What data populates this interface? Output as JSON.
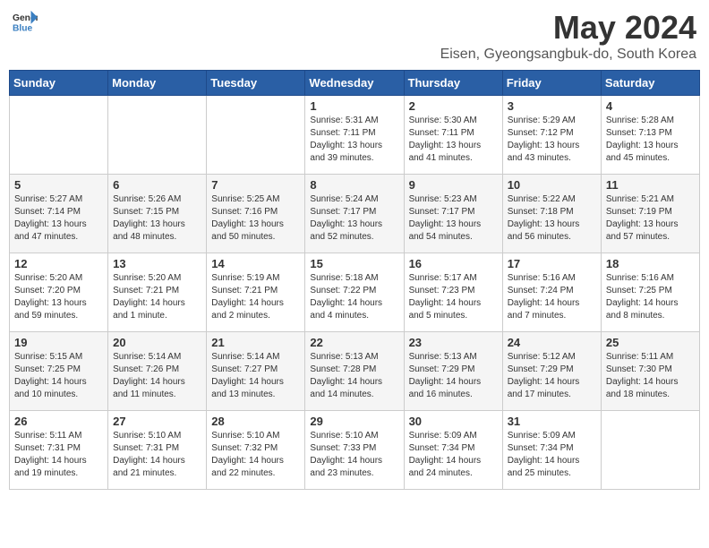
{
  "logo": {
    "text_general": "General",
    "text_blue": "Blue"
  },
  "title": "May 2024",
  "subtitle": "Eisen, Gyeongsangbuk-do, South Korea",
  "days_of_week": [
    "Sunday",
    "Monday",
    "Tuesday",
    "Wednesday",
    "Thursday",
    "Friday",
    "Saturday"
  ],
  "weeks": [
    [
      {
        "day": "",
        "info": ""
      },
      {
        "day": "",
        "info": ""
      },
      {
        "day": "",
        "info": ""
      },
      {
        "day": "1",
        "info": "Sunrise: 5:31 AM\nSunset: 7:11 PM\nDaylight: 13 hours\nand 39 minutes."
      },
      {
        "day": "2",
        "info": "Sunrise: 5:30 AM\nSunset: 7:11 PM\nDaylight: 13 hours\nand 41 minutes."
      },
      {
        "day": "3",
        "info": "Sunrise: 5:29 AM\nSunset: 7:12 PM\nDaylight: 13 hours\nand 43 minutes."
      },
      {
        "day": "4",
        "info": "Sunrise: 5:28 AM\nSunset: 7:13 PM\nDaylight: 13 hours\nand 45 minutes."
      }
    ],
    [
      {
        "day": "5",
        "info": "Sunrise: 5:27 AM\nSunset: 7:14 PM\nDaylight: 13 hours\nand 47 minutes."
      },
      {
        "day": "6",
        "info": "Sunrise: 5:26 AM\nSunset: 7:15 PM\nDaylight: 13 hours\nand 48 minutes."
      },
      {
        "day": "7",
        "info": "Sunrise: 5:25 AM\nSunset: 7:16 PM\nDaylight: 13 hours\nand 50 minutes."
      },
      {
        "day": "8",
        "info": "Sunrise: 5:24 AM\nSunset: 7:17 PM\nDaylight: 13 hours\nand 52 minutes."
      },
      {
        "day": "9",
        "info": "Sunrise: 5:23 AM\nSunset: 7:17 PM\nDaylight: 13 hours\nand 54 minutes."
      },
      {
        "day": "10",
        "info": "Sunrise: 5:22 AM\nSunset: 7:18 PM\nDaylight: 13 hours\nand 56 minutes."
      },
      {
        "day": "11",
        "info": "Sunrise: 5:21 AM\nSunset: 7:19 PM\nDaylight: 13 hours\nand 57 minutes."
      }
    ],
    [
      {
        "day": "12",
        "info": "Sunrise: 5:20 AM\nSunset: 7:20 PM\nDaylight: 13 hours\nand 59 minutes."
      },
      {
        "day": "13",
        "info": "Sunrise: 5:20 AM\nSunset: 7:21 PM\nDaylight: 14 hours\nand 1 minute."
      },
      {
        "day": "14",
        "info": "Sunrise: 5:19 AM\nSunset: 7:21 PM\nDaylight: 14 hours\nand 2 minutes."
      },
      {
        "day": "15",
        "info": "Sunrise: 5:18 AM\nSunset: 7:22 PM\nDaylight: 14 hours\nand 4 minutes."
      },
      {
        "day": "16",
        "info": "Sunrise: 5:17 AM\nSunset: 7:23 PM\nDaylight: 14 hours\nand 5 minutes."
      },
      {
        "day": "17",
        "info": "Sunrise: 5:16 AM\nSunset: 7:24 PM\nDaylight: 14 hours\nand 7 minutes."
      },
      {
        "day": "18",
        "info": "Sunrise: 5:16 AM\nSunset: 7:25 PM\nDaylight: 14 hours\nand 8 minutes."
      }
    ],
    [
      {
        "day": "19",
        "info": "Sunrise: 5:15 AM\nSunset: 7:25 PM\nDaylight: 14 hours\nand 10 minutes."
      },
      {
        "day": "20",
        "info": "Sunrise: 5:14 AM\nSunset: 7:26 PM\nDaylight: 14 hours\nand 11 minutes."
      },
      {
        "day": "21",
        "info": "Sunrise: 5:14 AM\nSunset: 7:27 PM\nDaylight: 14 hours\nand 13 minutes."
      },
      {
        "day": "22",
        "info": "Sunrise: 5:13 AM\nSunset: 7:28 PM\nDaylight: 14 hours\nand 14 minutes."
      },
      {
        "day": "23",
        "info": "Sunrise: 5:13 AM\nSunset: 7:29 PM\nDaylight: 14 hours\nand 16 minutes."
      },
      {
        "day": "24",
        "info": "Sunrise: 5:12 AM\nSunset: 7:29 PM\nDaylight: 14 hours\nand 17 minutes."
      },
      {
        "day": "25",
        "info": "Sunrise: 5:11 AM\nSunset: 7:30 PM\nDaylight: 14 hours\nand 18 minutes."
      }
    ],
    [
      {
        "day": "26",
        "info": "Sunrise: 5:11 AM\nSunset: 7:31 PM\nDaylight: 14 hours\nand 19 minutes."
      },
      {
        "day": "27",
        "info": "Sunrise: 5:10 AM\nSunset: 7:31 PM\nDaylight: 14 hours\nand 21 minutes."
      },
      {
        "day": "28",
        "info": "Sunrise: 5:10 AM\nSunset: 7:32 PM\nDaylight: 14 hours\nand 22 minutes."
      },
      {
        "day": "29",
        "info": "Sunrise: 5:10 AM\nSunset: 7:33 PM\nDaylight: 14 hours\nand 23 minutes."
      },
      {
        "day": "30",
        "info": "Sunrise: 5:09 AM\nSunset: 7:34 PM\nDaylight: 14 hours\nand 24 minutes."
      },
      {
        "day": "31",
        "info": "Sunrise: 5:09 AM\nSunset: 7:34 PM\nDaylight: 14 hours\nand 25 minutes."
      },
      {
        "day": "",
        "info": ""
      }
    ]
  ]
}
